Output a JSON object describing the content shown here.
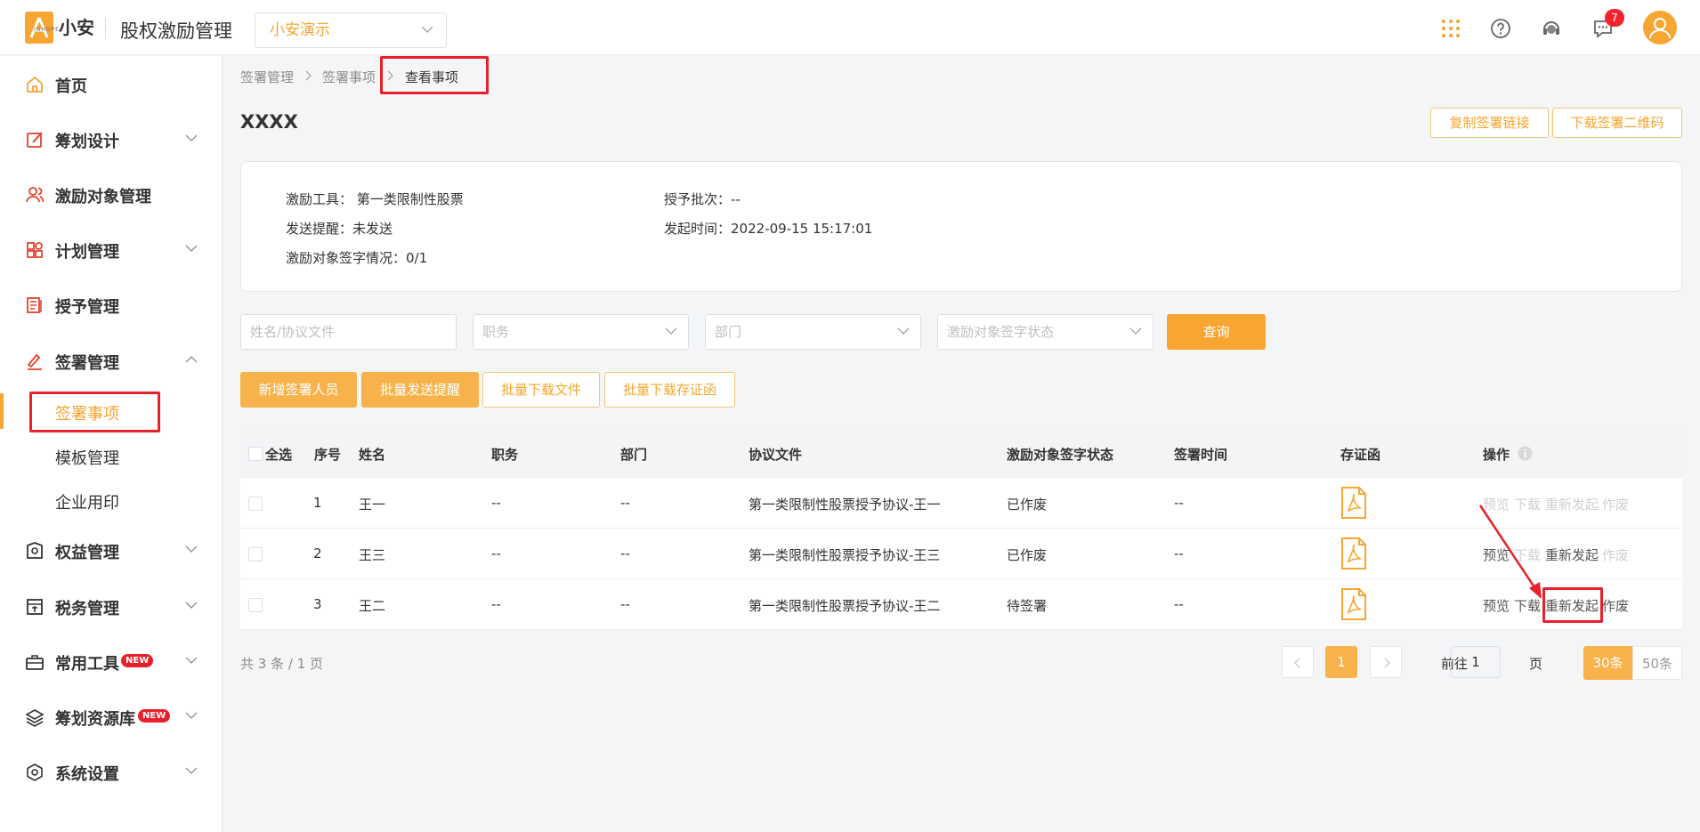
{
  "header": {
    "logo_text": "小安",
    "logo_sub": "INHOPE",
    "app_title": "股权激励管理",
    "company": "小安演示",
    "message_badge": "7"
  },
  "sidebar": {
    "items": [
      {
        "label": "首页",
        "icon": "home-icon"
      },
      {
        "label": "筹划设计",
        "icon": "edit-icon"
      },
      {
        "label": "激励对象管理",
        "icon": "users-icon"
      },
      {
        "label": "计划管理",
        "icon": "grid-icon"
      },
      {
        "label": "授予管理",
        "icon": "doc-icon"
      },
      {
        "label": "签署管理",
        "icon": "sign-icon"
      },
      {
        "label": "权益管理",
        "icon": "rights-icon"
      },
      {
        "label": "税务管理",
        "icon": "tax-icon"
      },
      {
        "label": "常用工具",
        "icon": "toolbox-icon",
        "tag": "NEW"
      },
      {
        "label": "筹划资源库",
        "icon": "layers-icon",
        "tag": "NEW"
      },
      {
        "label": "系统设置",
        "icon": "settings-icon"
      }
    ],
    "sub_items": [
      "签署事项",
      "模板管理",
      "企业用印"
    ]
  },
  "breadcrumb": [
    "签署管理",
    "签署事项",
    "查看事项"
  ],
  "page_title": "XXXX",
  "actions": {
    "copy_link": "复制签署链接",
    "download_qr": "下载签署二维码"
  },
  "info": {
    "tool_label": "激励工具：",
    "tool_value": "第一类限制性股票",
    "batch_label": "授予批次：",
    "batch_value": "--",
    "remind_label": "发送提醒：",
    "remind_value": "未发送",
    "time_label": "发起时间：",
    "time_value": "2022-09-15 15:17:01",
    "sign_label": "激励对象签字情况：",
    "sign_value": "0/1"
  },
  "filters": {
    "name_placeholder": "姓名/协议文件",
    "position_placeholder": "职务",
    "department_placeholder": "部门",
    "status_placeholder": "激励对象签字状态",
    "query": "查询"
  },
  "buttons": {
    "add": "新增签署人员",
    "batch_remind": "批量发送提醒",
    "batch_download": "批量下载文件",
    "batch_download_cert": "批量下载存证函"
  },
  "table": {
    "headers": [
      "全选",
      "序号",
      "姓名",
      "职务",
      "部门",
      "协议文件",
      "激励对象签字状态",
      "签署时间",
      "存证函",
      "操作"
    ],
    "rows": [
      {
        "no": "1",
        "name": "王一",
        "position": "--",
        "department": "--",
        "file": "第一类限制性股票授予协议-王一",
        "status": "已作废",
        "time": "--"
      },
      {
        "no": "2",
        "name": "王三",
        "position": "--",
        "department": "--",
        "file": "第一类限制性股票授予协议-王三",
        "status": "已作废",
        "time": "--"
      },
      {
        "no": "3",
        "name": "王二",
        "position": "--",
        "department": "--",
        "file": "第一类限制性股票授予协议-王二",
        "status": "待签署",
        "time": "--"
      }
    ],
    "ops": {
      "preview": "预览",
      "download": "下载",
      "resend": "重新发起",
      "void": "作废"
    }
  },
  "pagination": {
    "total": "共 3 条 / 1 页",
    "current": "1",
    "goto_label": "前往",
    "goto_value": "1",
    "page_unit": "页",
    "size_30": "30条",
    "size_50": "50条"
  },
  "colors": {
    "accent": "#f7a631",
    "highlight": "#e8202b"
  }
}
